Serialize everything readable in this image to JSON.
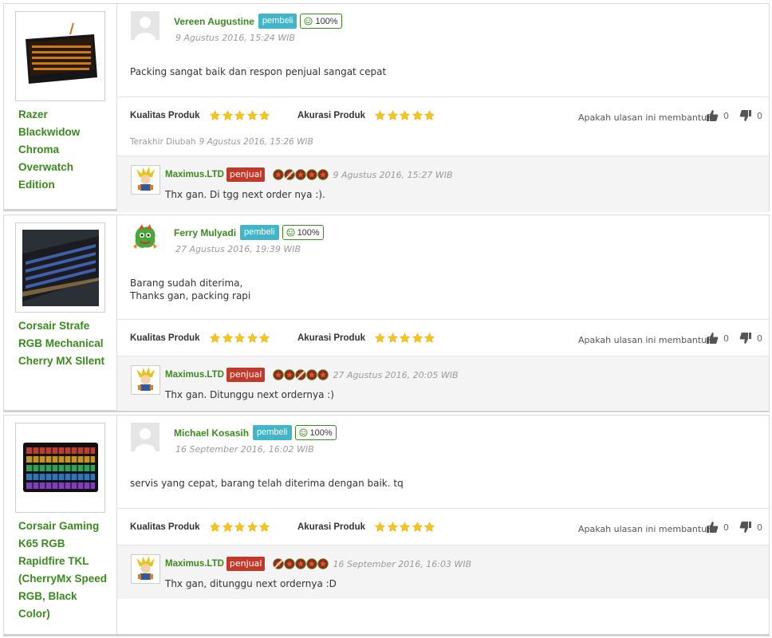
{
  "reviews": [
    {
      "product_name": "Razer Blackwidow Chroma Overwatch Edition",
      "reviewer": "Vereen Augustine",
      "reviewer_role": "pembeli",
      "reviewer_reputation": "100%",
      "avatar": "default-user-icon",
      "date": "9 Agustus 2016, 15:24 WIB",
      "text_lines": [
        "Packing sangat baik dan respon penjual sangat cepat"
      ],
      "quality_label": "Kualitas Produk",
      "quality_stars": 5,
      "accuracy_label": "Akurasi Produk",
      "accuracy_stars": 5,
      "helpful_question": "Apakah ulasan ini membantu?",
      "likes": "0",
      "dislikes": "0",
      "edited_label": "Terakhir Diubah",
      "edited_date": "9 Agustus 2016, 15:26 WIB",
      "reply": {
        "seller": "Maximus.LTD",
        "seller_role": "penjual",
        "date": "9 Agustus 2016, 15:27 WIB",
        "text": "Thx gan. Di tgg next order nya :)."
      }
    },
    {
      "product_name": "Corsair Strafe RGB Mechanical Cherry MX SIlent",
      "reviewer": "Ferry Mulyadi",
      "reviewer_role": "pembeli",
      "reviewer_reputation": "100%",
      "avatar": "dragon-avatar-icon",
      "date": "27 Agustus 2016, 19:39 WIB",
      "text_lines": [
        "Barang sudah diterima,",
        "Thanks gan, packing rapi"
      ],
      "quality_label": "Kualitas Produk",
      "quality_stars": 5,
      "accuracy_label": "Akurasi Produk",
      "accuracy_stars": 5,
      "helpful_question": "Apakah ulasan ini membantu?",
      "likes": "0",
      "dislikes": "0",
      "reply": {
        "seller": "Maximus.LTD",
        "seller_role": "penjual",
        "date": "27 Agustus 2016, 20:05 WIB",
        "text": "Thx gan. Ditunggu next ordernya :)"
      }
    },
    {
      "product_name": "Corsair Gaming K65 RGB Rapidfire TKL (CherryMx Speed RGB, Black Color)",
      "reviewer": "Michael Kosasih",
      "reviewer_role": "pembeli",
      "reviewer_reputation": "100%",
      "avatar": "default-user-icon",
      "date": "16 September 2016, 16:02 WIB",
      "text_lines": [
        "servis yang cepat, barang telah diterima dengan baik. tq"
      ],
      "quality_label": "Kualitas Produk",
      "quality_stars": 5,
      "accuracy_label": "Akurasi Produk",
      "accuracy_stars": 5,
      "helpful_question": "Apakah ulasan ini membantu?",
      "likes": "0",
      "dislikes": "0",
      "reply": {
        "seller": "Maximus.LTD",
        "seller_role": "penjual",
        "date": "16 September 2016, 16:03 WIB",
        "text": "Thx gan, ditunggu next ordernya :D"
      }
    }
  ],
  "colors": {
    "name_green": "#3a8a1e",
    "pembeli_badge": "#42b5c8",
    "penjual_badge": "#c0392b",
    "star_gold": "#f5c518",
    "reply_bg": "#f4f4f4"
  }
}
